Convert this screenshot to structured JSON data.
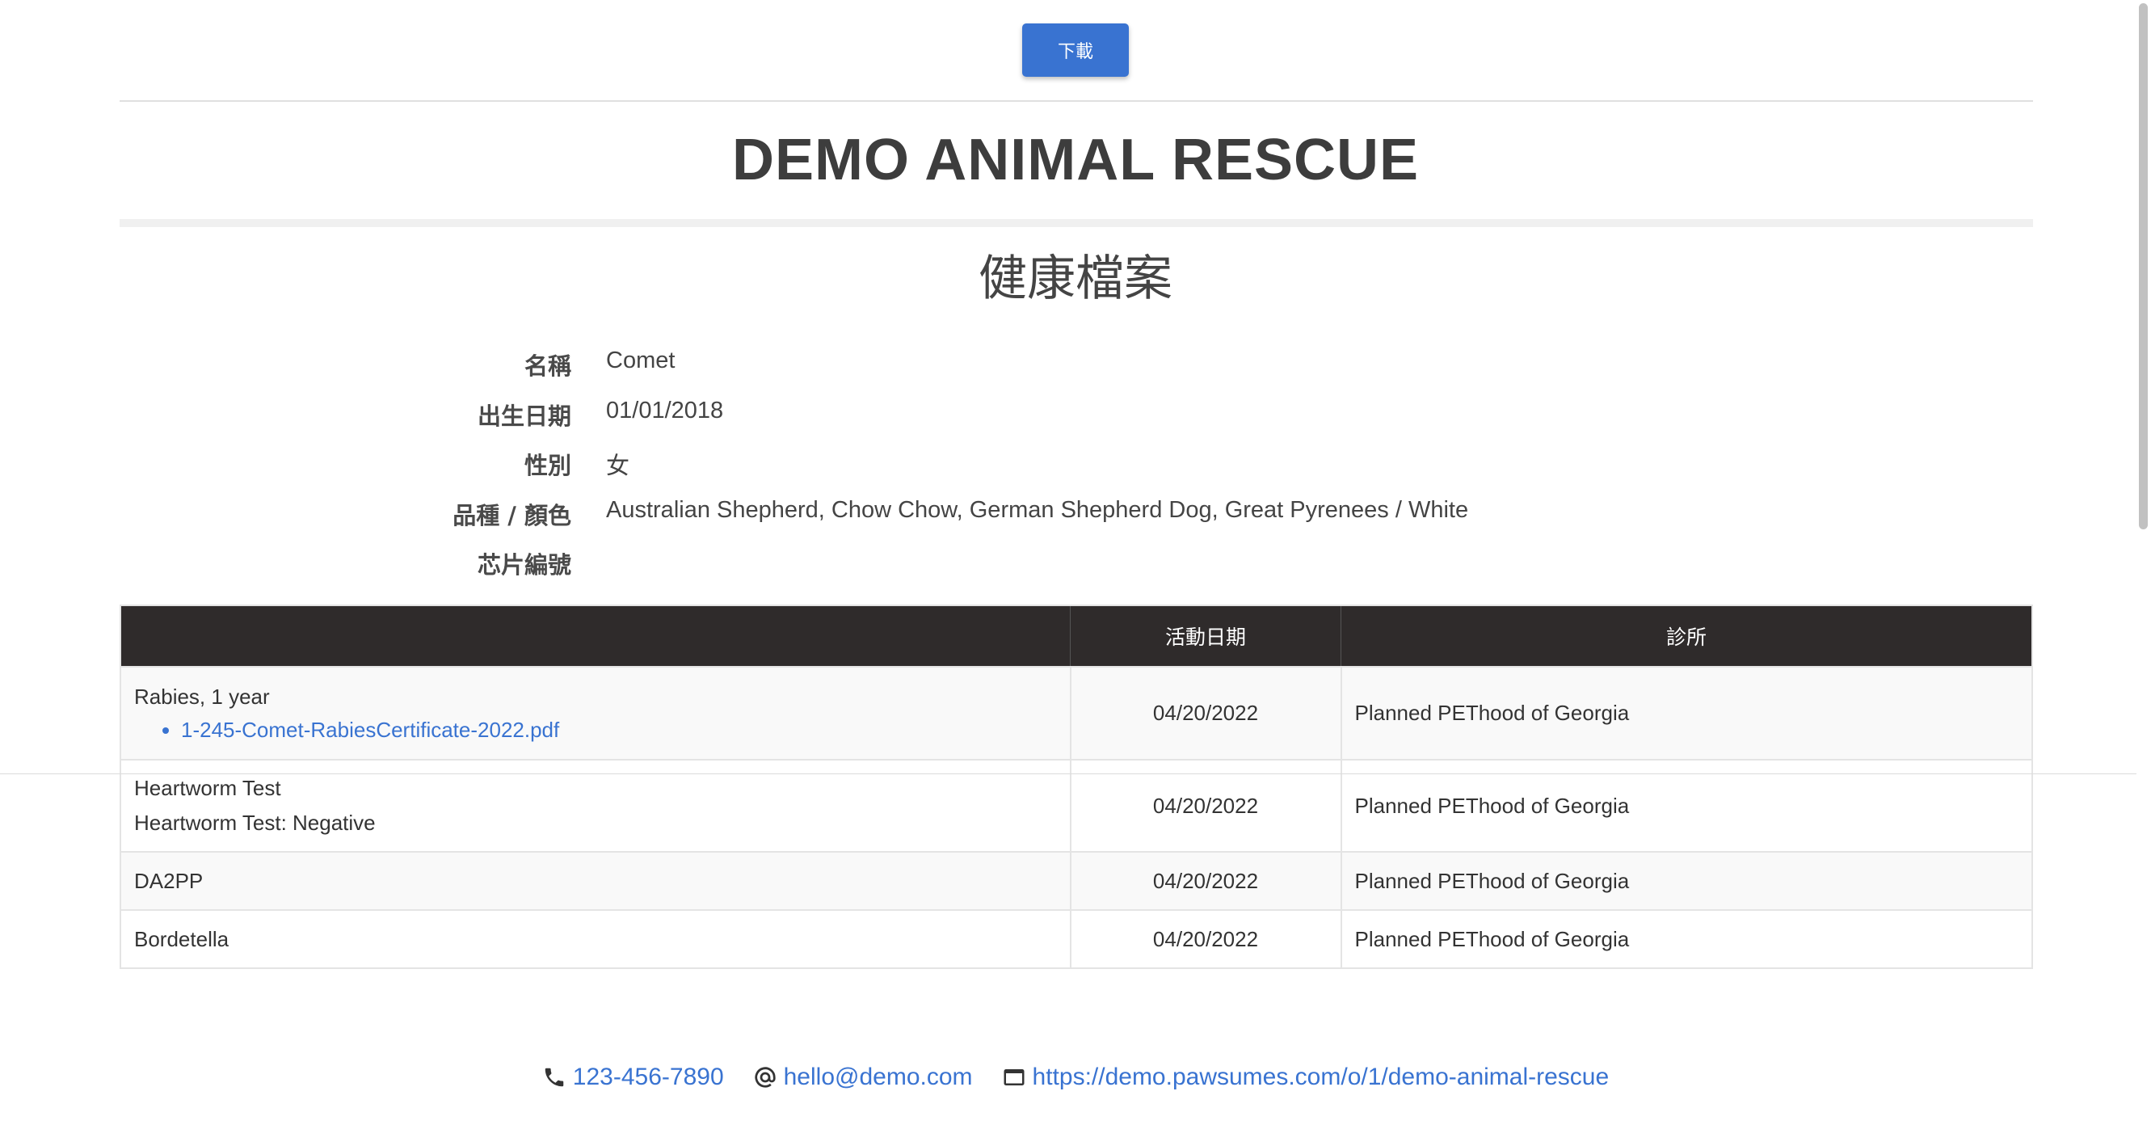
{
  "toolbar": {
    "download_label": "下載"
  },
  "organization": {
    "name": "DEMO ANIMAL RESCUE"
  },
  "document": {
    "title": "健康檔案"
  },
  "pet_info": [
    {
      "label": "名稱",
      "value": "Comet"
    },
    {
      "label": "出生日期",
      "value": "01/01/2018"
    },
    {
      "label": "性別",
      "value": "女"
    },
    {
      "label": "品種 / 顏色",
      "value": "Australian Shepherd, Chow Chow, German Shepherd Dog, Great Pyrenees / White"
    },
    {
      "label": "芯片編號",
      "value": ""
    }
  ],
  "records": {
    "headers": [
      "",
      "活動日期",
      "診所"
    ],
    "rows": [
      {
        "name": "Rabies, 1 year",
        "detail": "",
        "attachment": "1-245-Comet-RabiesCertificate-2022.pdf",
        "date": "04/20/2022",
        "clinic": "Planned PEThood of Georgia"
      },
      {
        "name": "Heartworm Test",
        "detail": "Heartworm Test: Negative",
        "attachment": "",
        "date": "04/20/2022",
        "clinic": "Planned PEThood of Georgia"
      },
      {
        "name": "DA2PP",
        "detail": "",
        "attachment": "",
        "date": "04/20/2022",
        "clinic": "Planned PEThood of Georgia"
      },
      {
        "name": "Bordetella",
        "detail": "",
        "attachment": "",
        "date": "04/20/2022",
        "clinic": "Planned PEThood of Georgia"
      }
    ]
  },
  "footer": {
    "phone": "123-456-7890",
    "email": "hello@demo.com",
    "website": "https://demo.pawsumes.com/o/1/demo-animal-rescue",
    "icons": {
      "phone": "phone-icon",
      "email": "at-sign-icon",
      "website": "browser-window-icon"
    }
  },
  "colors": {
    "accent": "#3973d1",
    "table_header_bg": "#2f2b2b",
    "title_text": "#3d3d3d"
  }
}
